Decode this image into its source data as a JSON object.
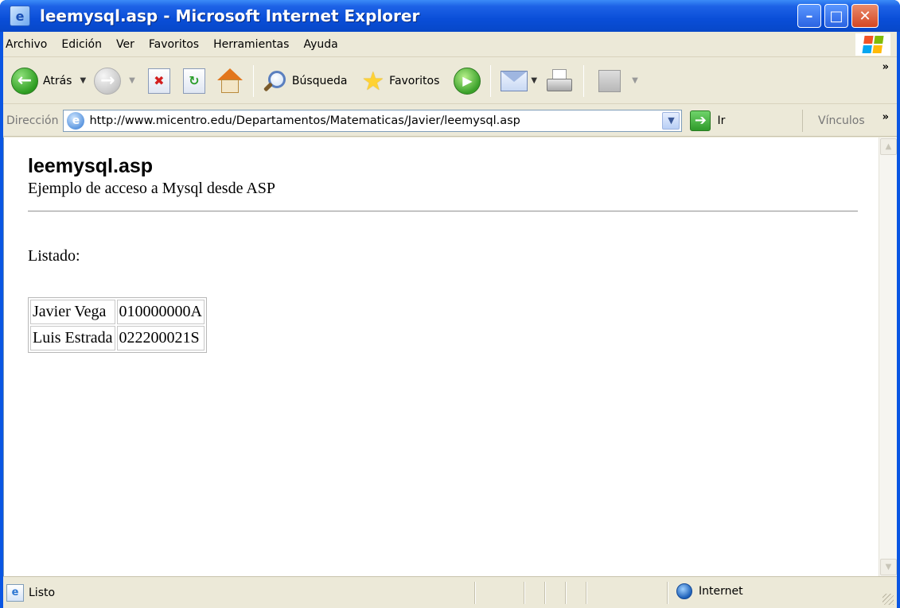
{
  "window": {
    "title": "leemysql.asp - Microsoft Internet Explorer"
  },
  "menu": {
    "items": [
      "Archivo",
      "Edición",
      "Ver",
      "Favoritos",
      "Herramientas",
      "Ayuda"
    ]
  },
  "toolbar": {
    "back_label": "Atrás",
    "search_label": "Búsqueda",
    "favorites_label": "Favoritos"
  },
  "address": {
    "label": "Dirección",
    "url": "http://www.micentro.edu/Departamentos/Matematicas/Javier/leemysql.asp",
    "go_label": "Ir",
    "links_label": "Vínculos"
  },
  "page": {
    "title": "leemysql.asp",
    "subtitle": "Ejemplo de acceso a Mysql desde ASP",
    "list_label": "Listado:",
    "rows": [
      [
        "Javier Vega",
        "010000000A"
      ],
      [
        "Luis Estrada",
        "022200021S"
      ]
    ]
  },
  "status": {
    "text": "Listo",
    "zone": "Internet"
  },
  "colors": {
    "titlebar": "#0a4ed8",
    "chrome": "#ece9d8",
    "close_button": "#d34622"
  }
}
